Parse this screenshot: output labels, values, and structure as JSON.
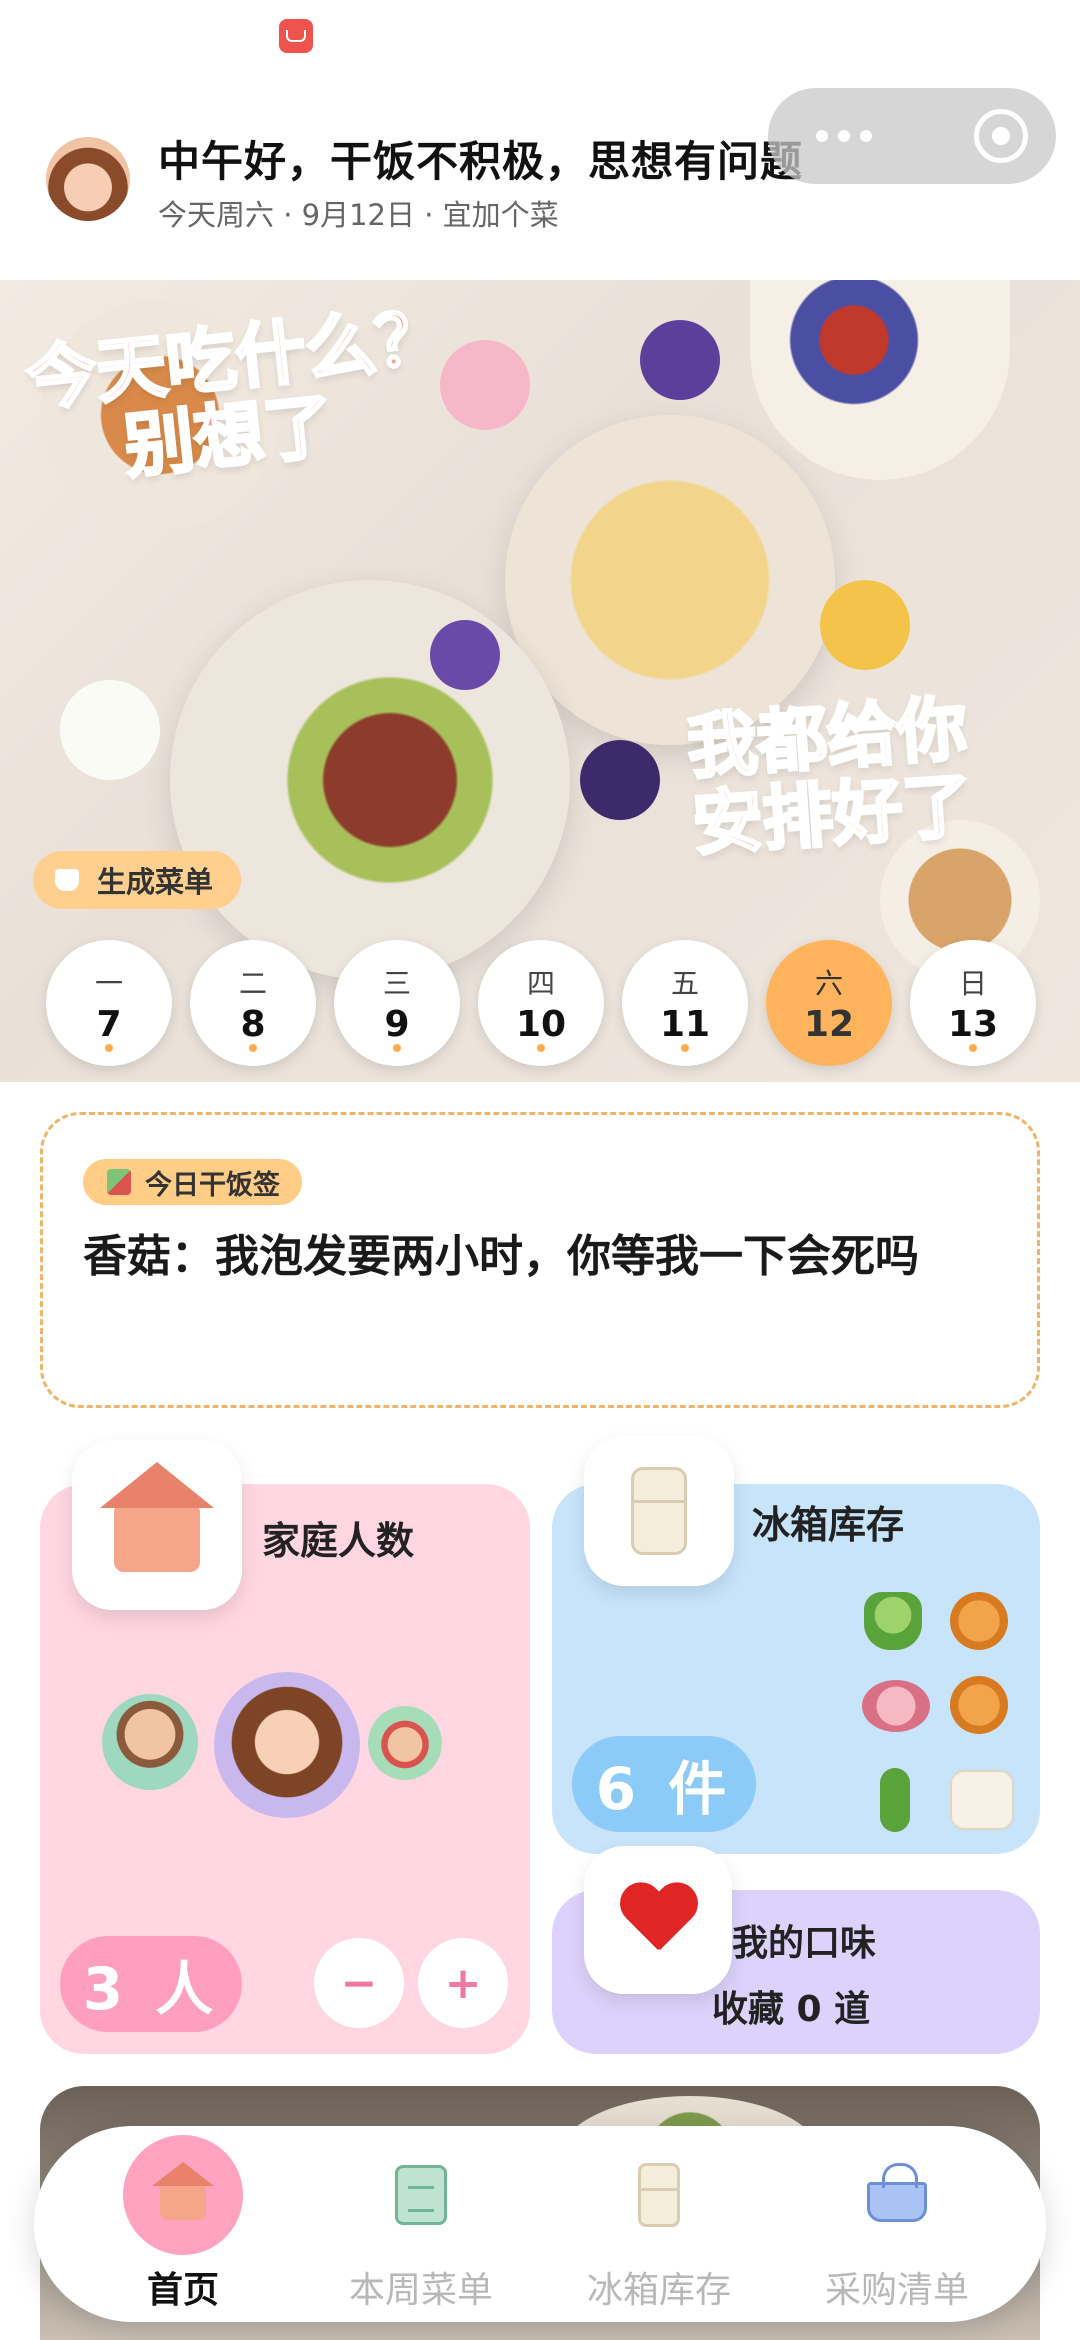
{
  "header": {
    "greeting": "中午好，干饭不积极，思想有问题",
    "subline": "今天周六 · 9月12日 · 宜加个菜"
  },
  "hero": {
    "title_line1": "今天吃什么？",
    "title_line2": "别想了",
    "tagline_line1": "我都给你",
    "tagline_line2": "安排好了",
    "generate_button": "生成菜单"
  },
  "week": [
    {
      "dow": "一",
      "date": "7",
      "active": false
    },
    {
      "dow": "二",
      "date": "8",
      "active": false
    },
    {
      "dow": "三",
      "date": "9",
      "active": false
    },
    {
      "dow": "四",
      "date": "10",
      "active": false
    },
    {
      "dow": "五",
      "date": "11",
      "active": false
    },
    {
      "dow": "六",
      "date": "12",
      "active": true
    },
    {
      "dow": "日",
      "date": "13",
      "active": false
    }
  ],
  "tip": {
    "badge": "今日干饭签",
    "text": "香菇：我泡发要两小时，你等我一下会死吗"
  },
  "family": {
    "title": "家庭人数",
    "count": "3 人",
    "minus": "−",
    "plus": "+"
  },
  "fridge": {
    "title": "冰箱库存",
    "count": "6 件"
  },
  "taste": {
    "title": "我的口味",
    "subtitle": "收藏 0 道"
  },
  "tabbar": [
    {
      "label": "首页",
      "icon": "home-icon",
      "active": true
    },
    {
      "label": "本周菜单",
      "icon": "menu-clipboard-icon",
      "active": false
    },
    {
      "label": "冰箱库存",
      "icon": "fridge-icon",
      "active": false
    },
    {
      "label": "采购清单",
      "icon": "basket-icon",
      "active": false
    }
  ],
  "colors": {
    "accent_orange": "#ffb35c",
    "pink_card": "#ffd6e2",
    "blue_card": "#c7e4fb",
    "purple_card": "#dcd2fb",
    "active_tab": "#ffa3c1"
  }
}
